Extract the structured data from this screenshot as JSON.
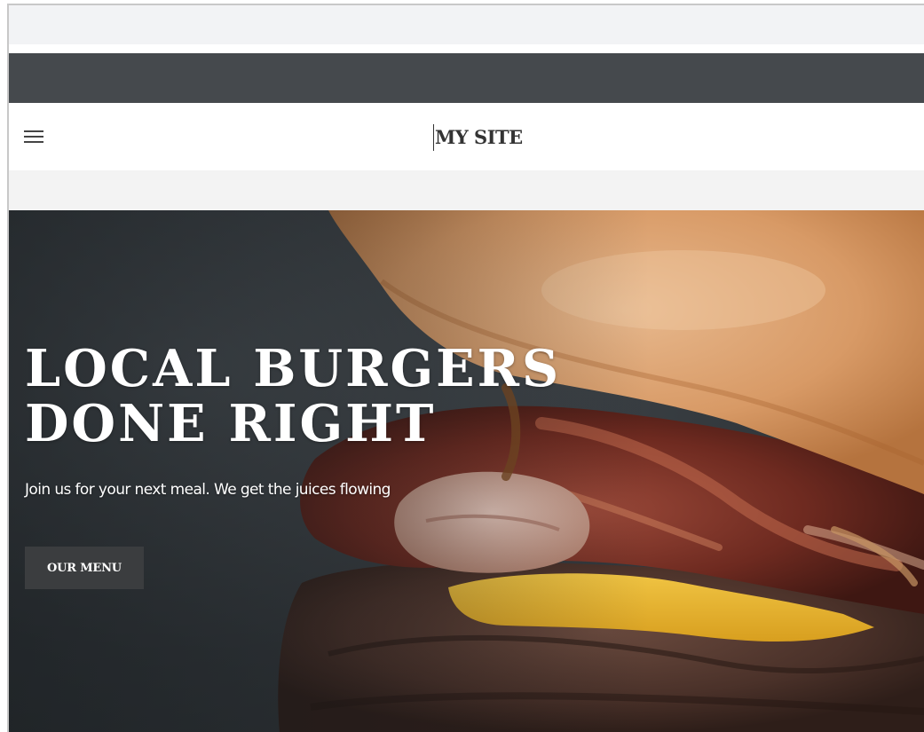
{
  "header": {
    "site_title": "MY SITE",
    "menu_icon": "hamburger-icon"
  },
  "hero": {
    "headline_line1": "LOCAL BURGERS",
    "headline_line2": "DONE RIGHT",
    "subtitle": "Join us for your next meal. We get the juices flowing",
    "cta_label": "OUR MENU",
    "background_image": "burger-photo"
  },
  "colors": {
    "dark_bar": "#45494d",
    "header_bg": "#ffffff",
    "page_bg": "#f3f3f3",
    "button_bg": "#3b3d3f",
    "hero_text": "#ffffff"
  }
}
